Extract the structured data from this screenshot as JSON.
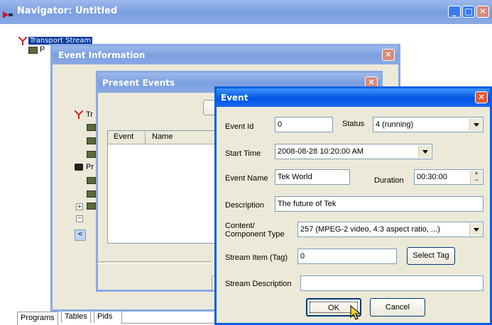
{
  "navigator": {
    "title": "Navigator: Untitled",
    "tree_root": "Transport Stream",
    "tree_child": "P",
    "tabs": [
      "Programs",
      "Tables",
      "Pids"
    ]
  },
  "event_information": {
    "title": "Event Information"
  },
  "present_events": {
    "title": "Present Events",
    "tree_partial_1": "Tr",
    "tree_partial_2": "Pr",
    "col_event": "Event",
    "col_name": "Name"
  },
  "event_dialog": {
    "title": "Event",
    "event_id_label": "Event Id",
    "event_id_value": "0",
    "status_label": "Status",
    "status_value": "4 (running)",
    "start_time_label": "Start Time",
    "start_time_value": "2008-08-28  10:20:00 AM",
    "event_name_label": "Event Name",
    "event_name_value": "Tek World",
    "duration_label": "Duration",
    "duration_value": "00:30:00",
    "description_label": "Description",
    "description_value": "The future of Tek",
    "content_label_1": "Content/",
    "content_label_2": "Component Type",
    "content_value": "257 (MPEG-2 video, 4:3 aspect ratio, ...)",
    "stream_item_label": "Stream Item (Tag)",
    "stream_item_value": "0",
    "select_tag_label": "Select Tag",
    "stream_desc_label": "Stream Description",
    "stream_desc_value": "",
    "ok_label": "OK",
    "cancel_label": "Cancel"
  },
  "colors": {
    "title_active": "#0a5fe0",
    "title_inactive": "#8aaae3",
    "dialog_bg": "#ece9d8",
    "close_red": "#e05a3a"
  }
}
